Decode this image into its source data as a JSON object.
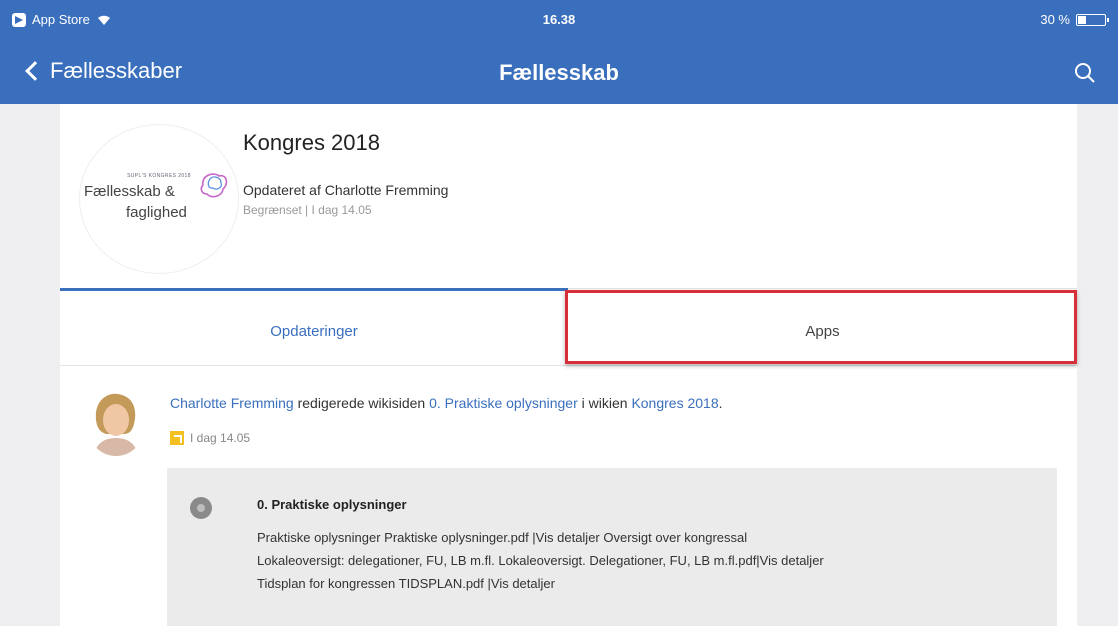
{
  "status_bar": {
    "back_app": "App Store",
    "time": "16.38",
    "battery": "30 %",
    "battery_level_percent": 30
  },
  "nav": {
    "back_label": "Fællesskaber",
    "title": "Fællesskab"
  },
  "community": {
    "logo_small": "SUPL'S KONGRES 2018",
    "logo_line1": "Fællesskab &",
    "logo_line2": "faglighed",
    "title": "Kongres 2018",
    "updated_by": "Opdateret af Charlotte Fremming",
    "meta": "Begrænset | I dag 14.05"
  },
  "tabs": {
    "updates": "Opdateringer",
    "apps": "Apps"
  },
  "activity": {
    "user": "Charlotte Fremming",
    "action": " redigerede wikisiden ",
    "page": "0. Praktiske oplysninger",
    "in_wiki": " i wikien ",
    "wiki": "Kongres 2018",
    "period": ".",
    "time": "I dag 14.05"
  },
  "wiki_card": {
    "title": "0. Praktiske oplysninger",
    "lines": [
      "Praktiske oplysninger Praktiske oplysninger.pdf |Vis detaljer Oversigt over kongressal",
      "Lokaleoversigt: delegationer, FU, LB m.fl. Lokaleoversigt. Delegationer, FU, LB m.fl.pdf|Vis detaljer",
      "Tidsplan for kongressen TIDSPLAN.pdf |Vis detaljer"
    ]
  },
  "colors": {
    "brand_blue": "#3a6fbd",
    "highlight_red": "#d62f3a",
    "notification_yellow": "#f3c01f"
  }
}
